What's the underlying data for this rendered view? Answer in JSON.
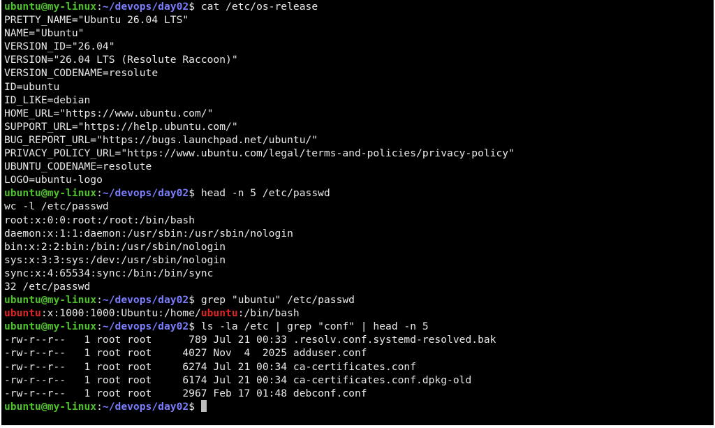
{
  "prompt": {
    "user_host": "ubuntu@my-linux",
    "colon": ":",
    "path": "~/devops/day02",
    "symbol": "$ "
  },
  "lines": {
    "cmd1": "cat /etc/os-release",
    "o1": "PRETTY_NAME=\"Ubuntu 26.04 LTS\"",
    "o2": "NAME=\"Ubuntu\"",
    "o3": "VERSION_ID=\"26.04\"",
    "o4": "VERSION=\"26.04 LTS (Resolute Raccoon)\"",
    "o5": "VERSION_CODENAME=resolute",
    "o6": "ID=ubuntu",
    "o7": "ID_LIKE=debian",
    "o8": "HOME_URL=\"https://www.ubuntu.com/\"",
    "o9": "SUPPORT_URL=\"https://help.ubuntu.com/\"",
    "o10": "BUG_REPORT_URL=\"https://bugs.launchpad.net/ubuntu/\"",
    "o11": "PRIVACY_POLICY_URL=\"https://www.ubuntu.com/legal/terms-and-policies/privacy-policy\"",
    "o12": "UBUNTU_CODENAME=resolute",
    "o13": "LOGO=ubuntu-logo",
    "cmd2": "head -n 5 /etc/passwd",
    "p1": "wc -l /etc/passwd",
    "p2": "root:x:0:0:root:/root:/bin/bash",
    "p3": "daemon:x:1:1:daemon:/usr/sbin:/usr/sbin/nologin",
    "p4": "bin:x:2:2:bin:/bin:/usr/sbin/nologin",
    "p5": "sys:x:3:3:sys:/dev:/usr/sbin/nologin",
    "p6": "sync:x:4:65534:sync:/bin:/bin/sync",
    "p7": "32 /etc/passwd",
    "cmd3": "grep \"ubuntu\" /etc/passwd",
    "g_match1": "ubuntu",
    "g_mid": ":x:1000:1000:Ubuntu:/home/",
    "g_match2": "ubuntu",
    "g_end": ":/bin/bash",
    "cmd4": "ls -la /etc | grep \"conf\" | head -n 5",
    "l1": "-rw-r--r--   1 root root      789 Jul 21 00:33 .resolv.conf.systemd-resolved.bak",
    "l2": "-rw-r--r--   1 root root     4027 Nov  4  2025 adduser.conf",
    "l3": "-rw-r--r--   1 root root     6274 Jul 21 00:34 ca-certificates.conf",
    "l4": "-rw-r--r--   1 root root     6174 Jul 21 00:34 ca-certificates.conf.dpkg-old",
    "l5": "-rw-r--r--   1 root root     2967 Feb 17 01:48 debconf.conf"
  },
  "colors": {
    "background": "#000000",
    "text": "#e8e8e8",
    "user_host": "#4ec22a",
    "path": "#7b7dff",
    "grep_match": "#e02424",
    "cursor": "#bdbdbd"
  }
}
